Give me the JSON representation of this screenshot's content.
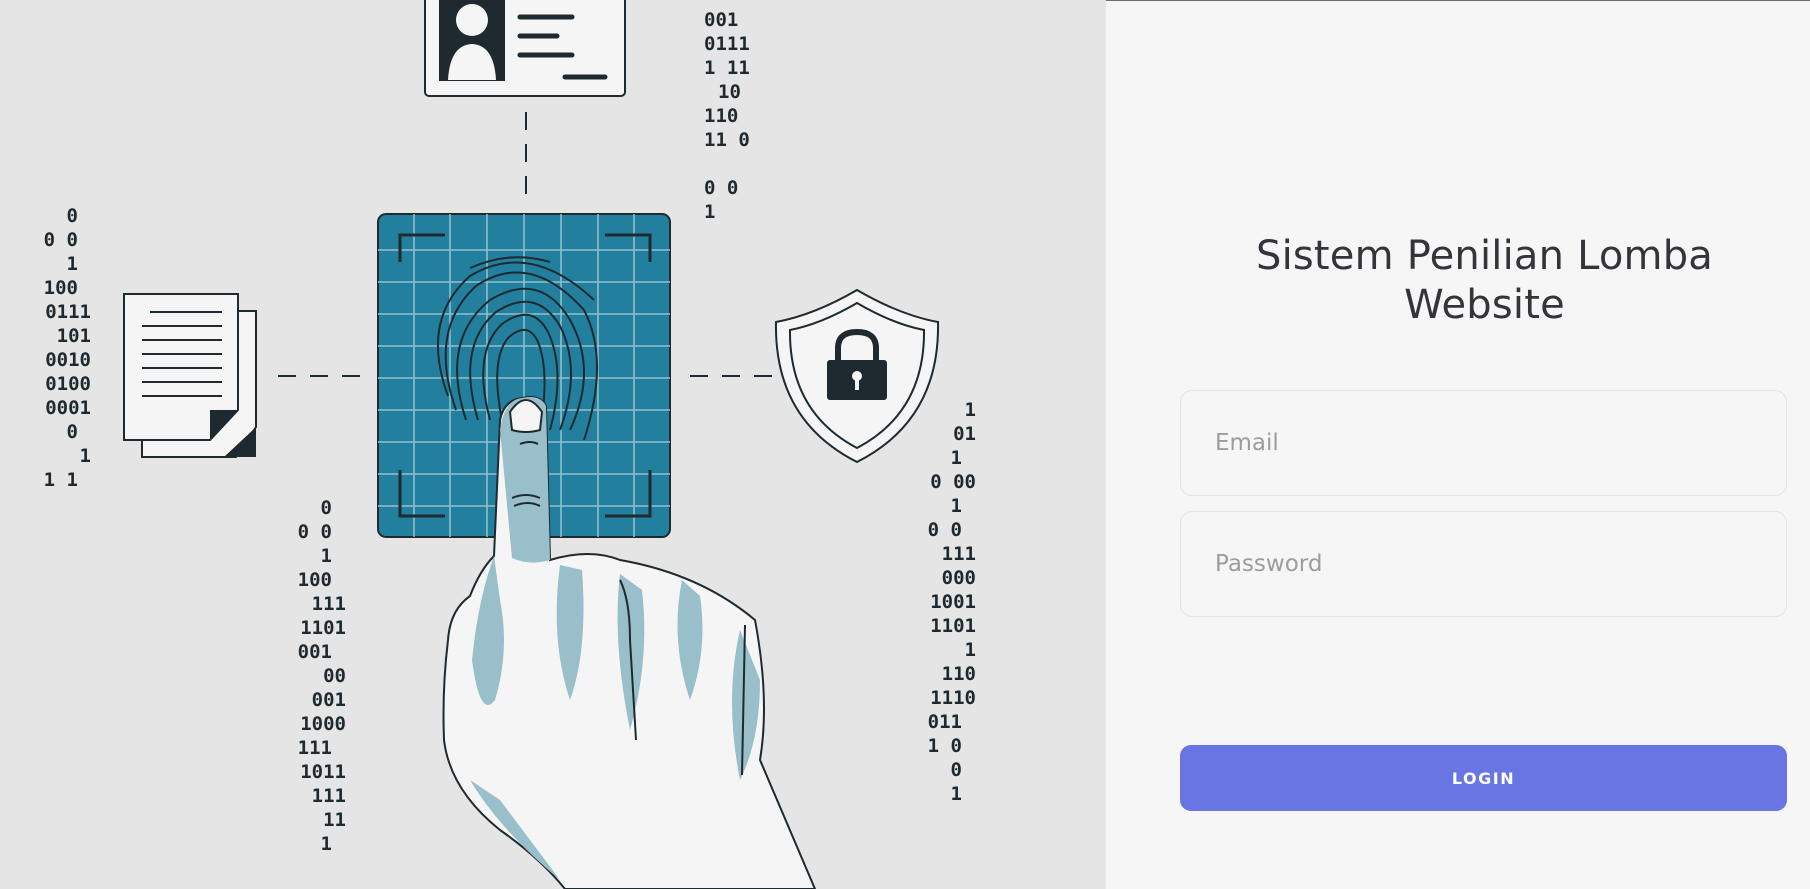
{
  "app": {
    "title_line1": "Sistem Penilian Lomba",
    "title_line2": "Website"
  },
  "form": {
    "email_placeholder": "Email",
    "password_placeholder": "Password",
    "login_label": "LOGIN"
  },
  "colors": {
    "left_background": "#e5e5e5",
    "right_background": "#f6f6f6",
    "button": "#6875e2",
    "scanner": "#22809e",
    "line_art": "#1e2a30"
  },
  "illustration": {
    "icons": [
      "id-card-icon",
      "document-icon",
      "fingerprint-scanner-icon",
      "shield-lock-icon",
      "hand-icon"
    ],
    "binary_columns": [
      [
        "0",
        "0   0",
        "1",
        "100",
        "0111",
        "101",
        "0010",
        "0100",
        "0001",
        "0",
        "1",
        "1   1"
      ],
      [
        "001",
        "0111",
        "1   11",
        "10",
        "110",
        "11   0",
        "",
        "0     0",
        "1"
      ],
      [
        "0",
        "0   0",
        "1",
        "100",
        "111",
        "1101",
        "001",
        "00",
        "001",
        "1000",
        "111",
        "1011",
        "111",
        "11",
        "1"
      ],
      [
        "1",
        "01",
        "1",
        "0   00",
        "1",
        "0   0",
        "111",
        "000",
        "1001",
        "1101",
        "1",
        "110",
        "1110",
        "011",
        "1   0",
        "0",
        "1"
      ]
    ]
  }
}
